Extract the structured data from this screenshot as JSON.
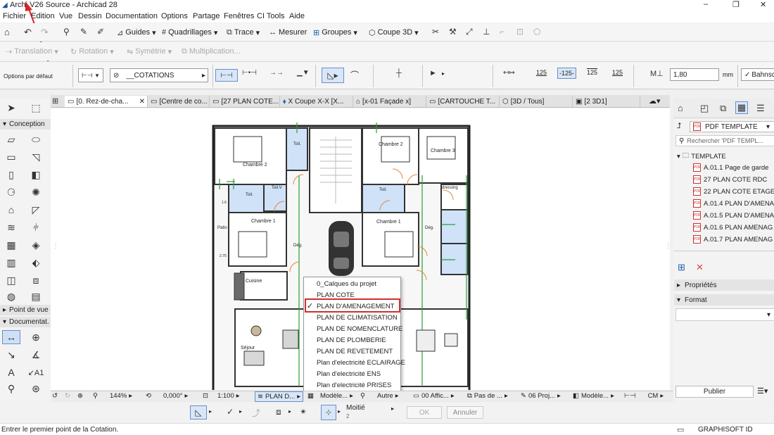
{
  "window": {
    "title": "Archi V26 Source - Archicad 28",
    "controls": [
      "–",
      "❐",
      "✕"
    ]
  },
  "menu": [
    "Fichier",
    "Edition",
    "Vue",
    "Dessin",
    "Documentation",
    "Options",
    "Partage",
    "Fenêtres",
    "CI Tools",
    "Aide"
  ],
  "toolbar1": {
    "guides": "Guides",
    "quadrillages": "Quadrillages",
    "trace": "Trace",
    "mesurer": "Mesurer",
    "groupes": "Groupes",
    "coupe3d": "Coupe 3D"
  },
  "toolbar2": {
    "translation": "Translation",
    "rotation": "Rotation",
    "symetrie": "Symétrie",
    "multiplication": "Multiplication..."
  },
  "infobox": {
    "options": "Options par défaut",
    "layer": "__COTATIONS",
    "fraction_a": "125",
    "fraction_b": "-125-",
    "fraction_c": "125",
    "fraction_d": "125",
    "value": "1,80",
    "unit": "mm",
    "check_label": "Bahnschi"
  },
  "tabs": [
    "[0. Rez-de-cha...",
    "[Centre de co...",
    "[27 PLAN COTE...",
    "X Coupe X-X [X...",
    "[x-01 Façade x]",
    "[CARTOUCHE T...",
    "[3D / Tous]",
    "[2 3D1]"
  ],
  "left_panel": {
    "conception": "Conception",
    "point_de_vue": "Point de vue",
    "documentation": "Documentat."
  },
  "right_panel": {
    "pdf_template": "PDF TEMPLATE",
    "search_placeholder": "Rechercher 'PDF TEMPL...",
    "folder": "TEMPLATE",
    "items": [
      "A.01.1 Page de garde",
      "27 PLAN COTE RDC",
      "22 PLAN COTE ETAGES",
      "A.01.4 PLAN D'AMENA",
      "A.01.5 PLAN D'AMENA",
      "A.01.6 PLAN AMENAG",
      "A.01.7 PLAN AMENAG"
    ],
    "proprietes": "Propriétés",
    "format": "Format",
    "publier": "Publier"
  },
  "plan_labels": {
    "chambre2a": "Chambre 2",
    "chambre2b": "Chambre 2",
    "chambre3": "Chambre 3",
    "toil1": "Toil.",
    "toil2": "Toil.",
    "toil3": "Toil.",
    "toilv": "Toil.V",
    "dressing": "dressing",
    "chambre1a": "Chambre 1",
    "chambre1b": "Chambre 1",
    "deg1": "Dég.",
    "deg2": "Dég.",
    "patio": "Patio",
    "cuisine": "Cuisine",
    "sejour": "Séjour",
    "dim1": "1.6",
    "dim2": "2.75"
  },
  "dropdown": {
    "items": [
      "0_Calques du projet",
      "PLAN COTE",
      "PLAN D'AMENAGEMENT",
      "PLAN DE CLIMATISATION",
      "PLAN DE NOMENCLATURE",
      "PLAN DE PLOMBERIE",
      "PLAN DE REVETEMENT",
      "Plan d'electricité ECLAIRAGE",
      "Plan d'electricité ENS",
      "Plan d'electricité PRISES"
    ],
    "checked_index": 2
  },
  "bottombar": {
    "zoom": "144%",
    "angle": "0,000°",
    "scale": "1:100",
    "layer_combo": "PLAN D...",
    "model": "Modèle...",
    "autre": "Autre",
    "affichage": "00 Affic...",
    "pas": "Pas de ...",
    "projet": "06 Proj...",
    "modele2": "Modèle...",
    "cm": "CM"
  },
  "snapbar": {
    "moitie": "Moitié",
    "moitie_num": "2",
    "ok": "OK",
    "annuler": "Annuler"
  },
  "status": {
    "message": "Entrer le premier point de la Cotation.",
    "brand": "GRAPHISOFT ID"
  }
}
